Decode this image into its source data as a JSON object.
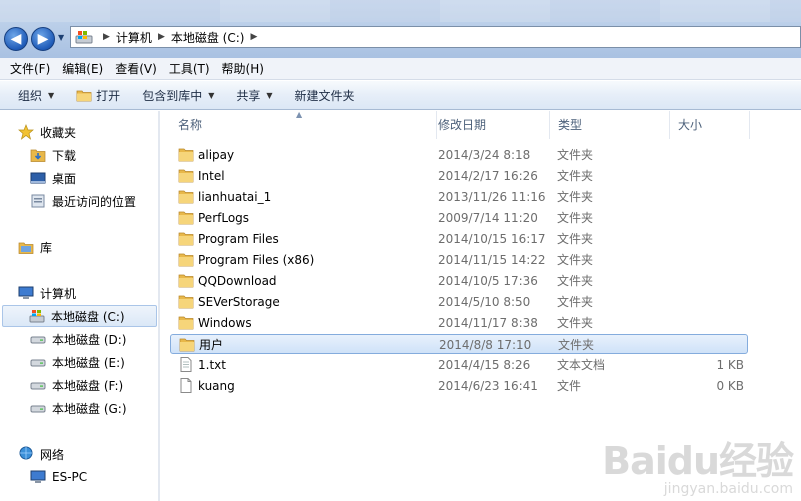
{
  "address": {
    "breadcrumbs": [
      "计算机",
      "本地磁盘 (C:)"
    ]
  },
  "menu": [
    "文件(F)",
    "编辑(E)",
    "查看(V)",
    "工具(T)",
    "帮助(H)"
  ],
  "commands": {
    "organize": "组织",
    "open": "打开",
    "include_library": "包含到库中",
    "share": "共享",
    "new_folder": "新建文件夹"
  },
  "sidebar": {
    "favorites": {
      "label": "收藏夹",
      "items": [
        "下载",
        "桌面",
        "最近访问的位置"
      ]
    },
    "library": {
      "label": "库"
    },
    "computer": {
      "label": "计算机",
      "drives": [
        "本地磁盘 (C:)",
        "本地磁盘 (D:)",
        "本地磁盘 (E:)",
        "本地磁盘 (F:)",
        "本地磁盘 (G:)"
      ],
      "selected_drive": "本地磁盘 (C:)"
    },
    "network": {
      "label": "网络",
      "items": [
        "ES-PC"
      ]
    }
  },
  "columns": {
    "name": "名称",
    "date": "修改日期",
    "type": "类型",
    "size": "大小"
  },
  "files": [
    {
      "name": "alipay",
      "date": "2014/3/24 8:18",
      "type": "文件夹",
      "size": "",
      "kind": "folder"
    },
    {
      "name": "Intel",
      "date": "2014/2/17 16:26",
      "type": "文件夹",
      "size": "",
      "kind": "folder"
    },
    {
      "name": "lianhuatai_1",
      "date": "2013/11/26 11:16",
      "type": "文件夹",
      "size": "",
      "kind": "folder"
    },
    {
      "name": "PerfLogs",
      "date": "2009/7/14 11:20",
      "type": "文件夹",
      "size": "",
      "kind": "folder"
    },
    {
      "name": "Program Files",
      "date": "2014/10/15 16:17",
      "type": "文件夹",
      "size": "",
      "kind": "folder"
    },
    {
      "name": "Program Files (x86)",
      "date": "2014/11/15 14:22",
      "type": "文件夹",
      "size": "",
      "kind": "folder"
    },
    {
      "name": "QQDownload",
      "date": "2014/10/5 17:36",
      "type": "文件夹",
      "size": "",
      "kind": "folder"
    },
    {
      "name": "SEVerStorage",
      "date": "2014/5/10 8:50",
      "type": "文件夹",
      "size": "",
      "kind": "folder"
    },
    {
      "name": "Windows",
      "date": "2014/11/17 8:38",
      "type": "文件夹",
      "size": "",
      "kind": "folder"
    },
    {
      "name": "用户",
      "date": "2014/8/8 17:10",
      "type": "文件夹",
      "size": "",
      "kind": "folder",
      "selected": true
    },
    {
      "name": "1.txt",
      "date": "2014/4/15 8:26",
      "type": "文本文档",
      "size": "1 KB",
      "kind": "text"
    },
    {
      "name": "kuang",
      "date": "2014/6/23 16:41",
      "type": "文件",
      "size": "0 KB",
      "kind": "file"
    }
  ],
  "watermark": {
    "main": "Baidu经验",
    "sub": "jingyan.baidu.com"
  },
  "colors": {
    "selection_border": "#84acdd",
    "folder": "#e8b84a",
    "nav_button": "#1f5bb8"
  }
}
